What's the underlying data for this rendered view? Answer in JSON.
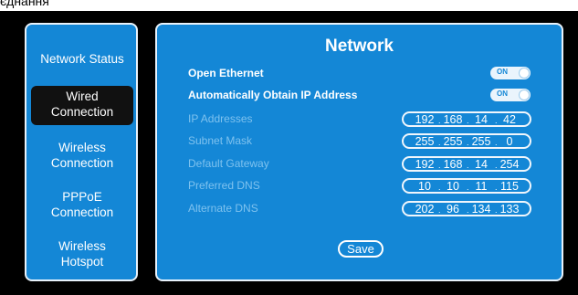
{
  "top_strip": {
    "text": "єднання"
  },
  "sidebar": {
    "items": [
      {
        "label_lines": [
          "Network Status"
        ]
      },
      {
        "label_lines": [
          "Wired",
          "Connection"
        ],
        "active": true
      },
      {
        "label_lines": [
          "Wireless",
          "Connection"
        ]
      },
      {
        "label_lines": [
          "PPPoE",
          "Connection"
        ]
      },
      {
        "label_lines": [
          "Wireless",
          "Hotspot"
        ]
      }
    ]
  },
  "main": {
    "title": "Network",
    "toggles": [
      {
        "label": "Open Ethernet",
        "state": "ON"
      },
      {
        "label": "Automatically Obtain IP Address",
        "state": "ON"
      }
    ],
    "fields": [
      {
        "label": "IP Addresses",
        "octets": [
          "192",
          "168",
          "14",
          "42"
        ]
      },
      {
        "label": "Subnet Mask",
        "octets": [
          "255",
          "255",
          "255",
          "0"
        ]
      },
      {
        "label": "Default Gateway",
        "octets": [
          "192",
          "168",
          "14",
          "254"
        ]
      },
      {
        "label": "Preferred DNS",
        "octets": [
          "10",
          "10",
          "11",
          "115"
        ]
      },
      {
        "label": "Alternate DNS",
        "octets": [
          "202",
          "96",
          "134",
          "133"
        ]
      }
    ],
    "save_label": "Save"
  },
  "colors": {
    "panel_blue": "#1487d6",
    "active_nav": "#111111",
    "dim_label": "#7ec2ef",
    "background": "#000000"
  }
}
